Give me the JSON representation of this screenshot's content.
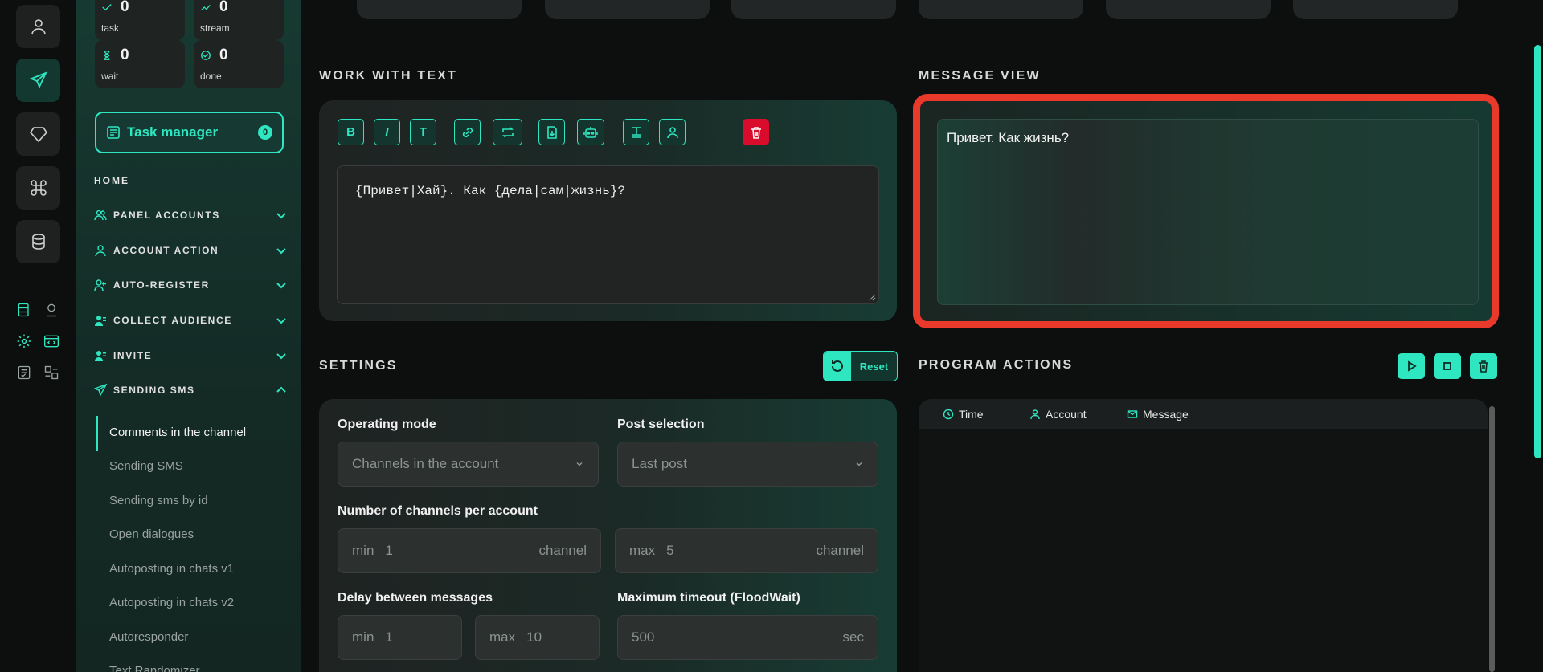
{
  "stats": [
    {
      "value": "0",
      "label": "task",
      "icon": "task-icon"
    },
    {
      "value": "0",
      "label": "stream",
      "icon": "stream-icon"
    },
    {
      "value": "0",
      "label": "wait",
      "icon": "hourglass-icon"
    },
    {
      "value": "0",
      "label": "done",
      "icon": "check-icon"
    }
  ],
  "task_manager": {
    "label": "Task manager",
    "count": "0"
  },
  "nav": {
    "home": "HOME",
    "items": [
      {
        "label": "PANEL ACCOUNTS",
        "icon": "users-icon",
        "expanded": false
      },
      {
        "label": "ACCOUNT ACTION",
        "icon": "user-icon",
        "expanded": false
      },
      {
        "label": "AUTO-REGISTER",
        "icon": "user-plus-icon",
        "expanded": false
      },
      {
        "label": "COLLECT AUDIENCE",
        "icon": "user-list-icon",
        "expanded": false
      },
      {
        "label": "INVITE",
        "icon": "user-list-icon",
        "expanded": false
      },
      {
        "label": "SENDING SMS",
        "icon": "send-icon",
        "expanded": true
      }
    ],
    "sub_items": [
      {
        "label": "Comments in the channel",
        "active": true
      },
      {
        "label": "Sending SMS",
        "active": false
      },
      {
        "label": "Sending sms by id",
        "active": false
      },
      {
        "label": "Open dialogues",
        "active": false
      },
      {
        "label": "Autoposting in chats v1",
        "active": false
      },
      {
        "label": "Autoposting in chats v2",
        "active": false
      },
      {
        "label": "Autoresponder",
        "active": false
      },
      {
        "label": "Text Randomizer",
        "active": false
      }
    ]
  },
  "work_with_text": {
    "title": "WORK WITH TEXT",
    "text": "{Привет|Хай}. Как {дела|сам|жизнь}?",
    "toolbar": [
      {
        "label": "B",
        "icon": "bold-icon"
      },
      {
        "label": "I",
        "icon": "italic-icon"
      },
      {
        "label": "T",
        "icon": "text-icon"
      },
      {
        "label": "",
        "icon": "link-icon"
      },
      {
        "label": "",
        "icon": "repeat-icon"
      },
      {
        "label": "",
        "icon": "file-download-icon"
      },
      {
        "label": "",
        "icon": "robot-icon"
      },
      {
        "label": "",
        "icon": "text-format-icon"
      },
      {
        "label": "",
        "icon": "user-icon"
      },
      {
        "label": "",
        "icon": "trash-icon"
      }
    ]
  },
  "message_view": {
    "title": "MESSAGE VIEW",
    "text": "Привет. Как жизнь?"
  },
  "settings": {
    "title": "SETTINGS",
    "reset_label": "Reset",
    "operating_mode": {
      "label": "Operating mode",
      "value": "Channels in the account"
    },
    "post_selection": {
      "label": "Post selection",
      "value": "Last post"
    },
    "channels_per_account": {
      "label": "Number of channels per account",
      "min_prefix": "min",
      "min_value": "1",
      "max_prefix": "max",
      "max_value": "5",
      "unit": "channel"
    },
    "delay": {
      "label": "Delay between messages",
      "min_prefix": "min",
      "min_value": "1",
      "max_prefix": "max",
      "max_value": "10"
    },
    "timeout": {
      "label": "Maximum timeout (FloodWait)",
      "value": "500",
      "unit": "sec"
    }
  },
  "program_actions": {
    "title": "PROGRAM ACTIONS",
    "columns": [
      {
        "label": "Time",
        "icon": "clock-icon"
      },
      {
        "label": "Account",
        "icon": "user-icon"
      },
      {
        "label": "Message",
        "icon": "mail-icon"
      }
    ]
  },
  "colors": {
    "accent": "#2ee6c0",
    "danger": "#d90d2b",
    "highlight": "#e8392a"
  }
}
